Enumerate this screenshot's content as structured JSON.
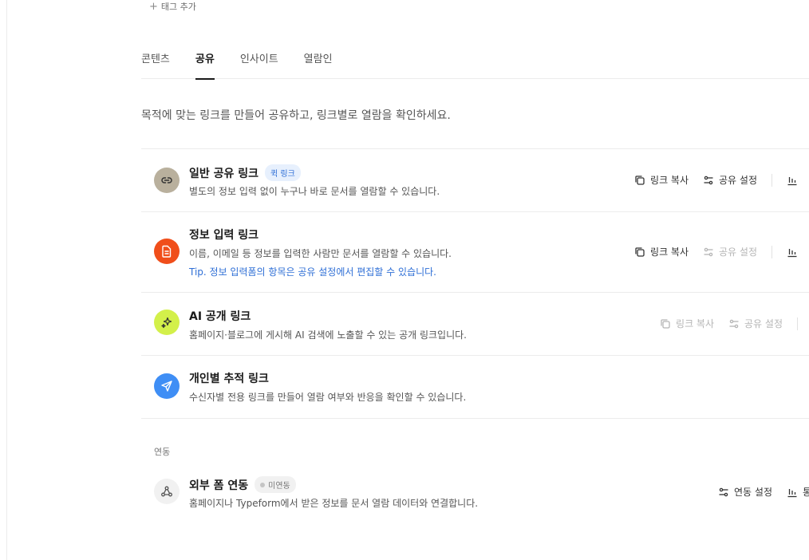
{
  "tag_add": {
    "label": "태그 추가"
  },
  "tabs": [
    {
      "label": "콘텐츠",
      "active": false
    },
    {
      "label": "공유",
      "active": true
    },
    {
      "label": "인사이트",
      "active": false
    },
    {
      "label": "열람인",
      "active": false
    }
  ],
  "description": "목적에 맞는 링크를 만들어 공유하고, 링크별로 열람을 확인하세요.",
  "links": [
    {
      "title": "일반 공유 링크",
      "badge": "퀵 링크",
      "subtitle": "별도의 정보 입력 없이 누구나 바로 문서를 열람할 수 있습니다.",
      "icon": "link-icon",
      "icon_color": "#b9b09d",
      "copy_label": "링크 복사",
      "settings_label": "공유 설정",
      "copy_enabled": true,
      "settings_enabled": true
    },
    {
      "title": "정보 입력 링크",
      "subtitle": "이름, 이메일 등 정보를 입력한 사람만 문서를 열람할 수 있습니다.",
      "tip": "Tip. 정보 입력폼의 항목은 공유 설정에서 편집할 수 있습니다.",
      "icon": "document-icon",
      "icon_color": "#f04e1a",
      "copy_label": "링크 복사",
      "settings_label": "공유 설정",
      "copy_enabled": true,
      "settings_enabled": false
    },
    {
      "title": "AI 공개 링크",
      "subtitle": "홈페이지·블로그에 게시해 AI 검색에 노출할 수 있는 공개 링크입니다.",
      "icon": "sparkle-icon",
      "icon_color": "#d3f04a",
      "copy_label": "링크 복사",
      "settings_label": "공유 설정",
      "copy_enabled": false,
      "settings_enabled": false
    },
    {
      "title": "개인별 추적 링크",
      "subtitle": "수신자별 전용 링크를 만들어 열람 여부와 반응을 확인할 수 있습니다.",
      "icon": "send-icon",
      "icon_color": "#3f8ef5"
    }
  ],
  "integration": {
    "section_label": "연동",
    "title": "외부 폼 연동",
    "status": "미연동",
    "subtitle": "홈페이지나 Typeform에서 받은 정보를 문서 열람 데이터와 연결합니다.",
    "settings_label": "연동 설정",
    "stats_label": "통계"
  }
}
